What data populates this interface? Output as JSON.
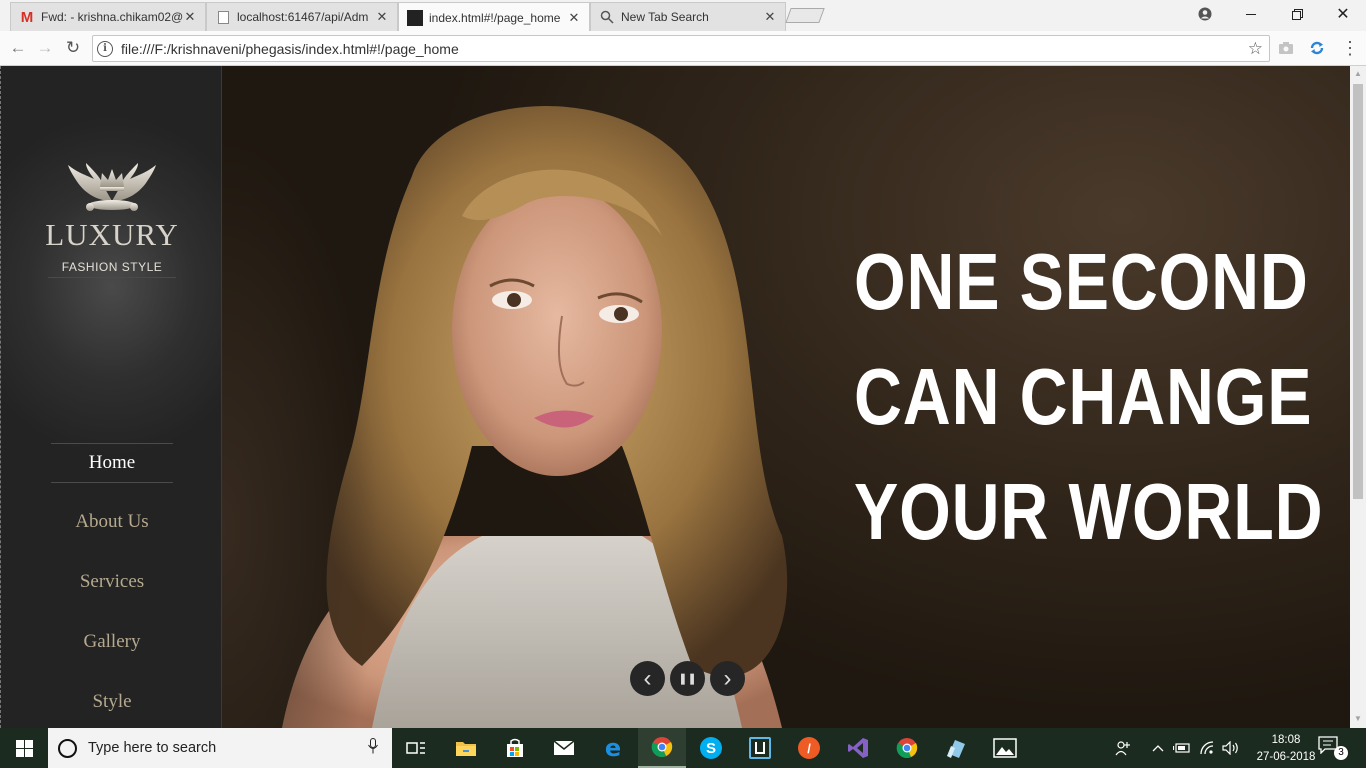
{
  "browser": {
    "tabs": [
      {
        "title": "Fwd: - krishna.chikam02@",
        "favicon": "gmail-icon",
        "active": false
      },
      {
        "title": "localhost:61467/api/Adm",
        "favicon": "page-icon",
        "active": false
      },
      {
        "title": "index.html#!/page_home",
        "favicon": "luxury-favicon",
        "active": true
      },
      {
        "title": "New Tab Search",
        "favicon": "search-icon",
        "active": false
      }
    ],
    "tab_close_glyph": "✕",
    "address": "file:///F:/krishnaveni/phegasis/index.html#!/page_home"
  },
  "site": {
    "logo": {
      "brand": "LUXURY",
      "tagline": "FASHION STYLE"
    },
    "nav": [
      {
        "label": "Home",
        "active": true
      },
      {
        "label": "About Us",
        "active": false
      },
      {
        "label": "Services",
        "active": false
      },
      {
        "label": "Gallery",
        "active": false
      },
      {
        "label": "Style",
        "active": false
      }
    ],
    "hero": {
      "headline": [
        "ONE SECOND",
        "CAN CHANGE",
        "YOUR WORLD"
      ],
      "controls": {
        "prev": "‹",
        "pause": "❚❚",
        "next": "›"
      }
    }
  },
  "taskbar": {
    "search_placeholder": "Type here to search",
    "pinned": [
      "task-view-icon",
      "file-explorer-icon",
      "store-icon",
      "mail-icon",
      "edge-icon",
      "chrome-icon",
      "skype-icon",
      "remote-desktop-icon",
      "postman-icon",
      "visual-studio-icon",
      "chrome-icon",
      "notes-app-icon",
      "photos-icon"
    ],
    "clock": {
      "time": "18:08",
      "date": "27-06-2018"
    },
    "notifications": "3"
  },
  "colors": {
    "nav_text": "#b6a98f",
    "nav_active": "#ffffff",
    "taskbar": "#1c2b1f",
    "headline": "#ffffff"
  }
}
